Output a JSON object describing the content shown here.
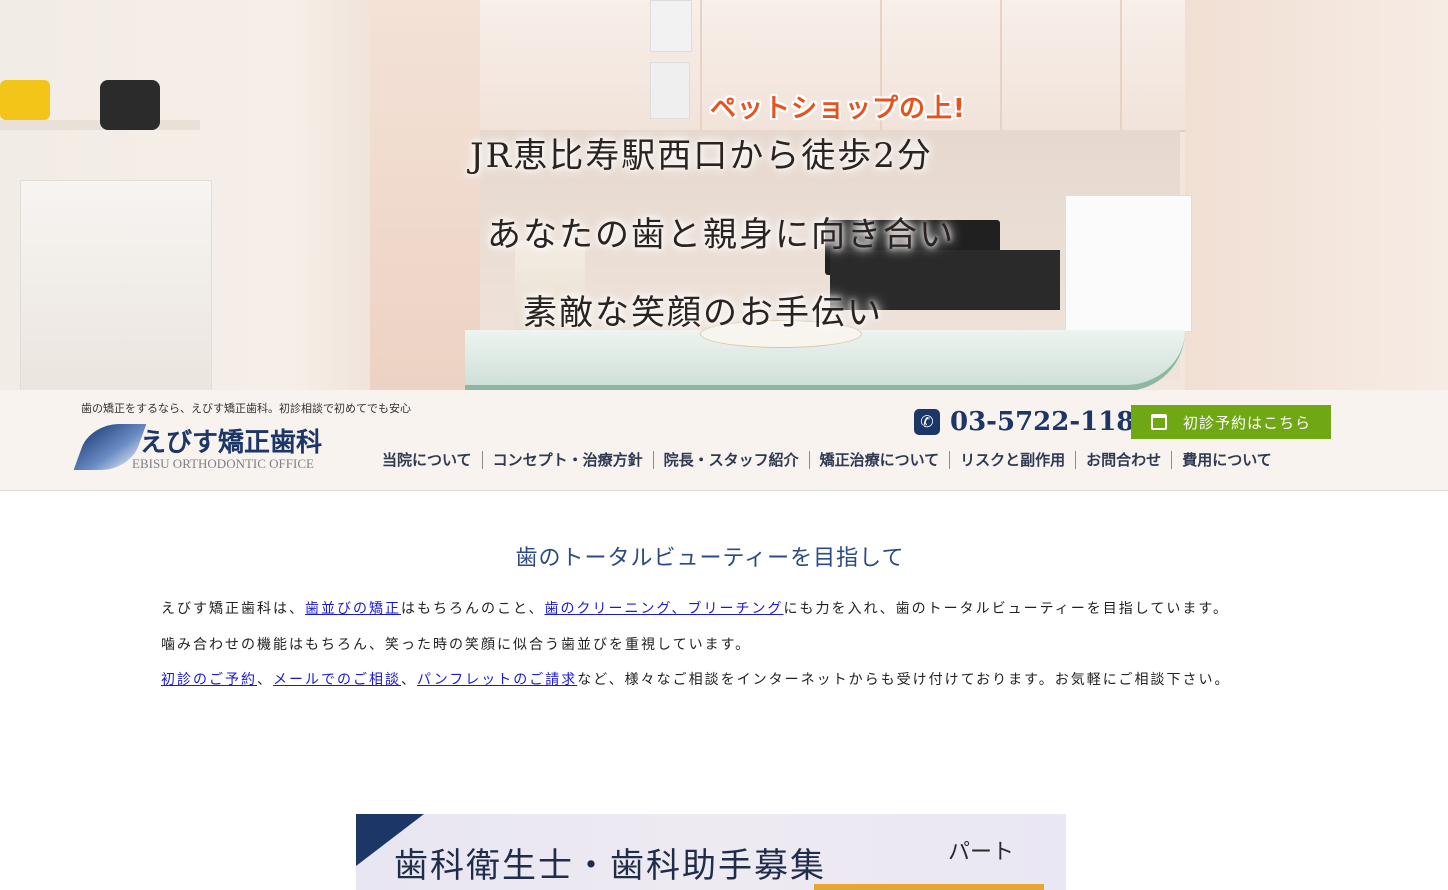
{
  "hero": {
    "pet_tag": "ペットショップの上!",
    "catch_lines": [
      "JR恵比寿駅西口から徒歩2分",
      "あなたの歯と親身に向き合い",
      "素敵な笑顔のお手伝い"
    ]
  },
  "header": {
    "tagline": "歯の矯正をするなら、えびす矯正歯科。初診相談で初めてでも安心",
    "logo_name": "えびす矯正歯科",
    "logo_en": "EBISU ORTHODONTIC OFFICE",
    "phone": "03-5722-1182",
    "reserve_label": "初診予約はこちら"
  },
  "nav": {
    "items": [
      {
        "label": "当院について"
      },
      {
        "label": "コンセプト・治療方針"
      },
      {
        "label": "院長・スタッフ紹介"
      },
      {
        "label": "矯正治療について"
      },
      {
        "label": "リスクと副作用"
      },
      {
        "label": "お問合わせ"
      },
      {
        "label": "費用について"
      }
    ]
  },
  "main": {
    "title": "歯のトータルビューティーを目指して",
    "para1": {
      "t1": "えびす矯正歯科は、",
      "link1": "歯並びの矯正",
      "t2": "はもちろんのこと、",
      "link2": "歯のクリーニング、ブリーチング",
      "t3": "にも力を入れ、歯のトータルビューティーを目指しています。"
    },
    "para2": "噛み合わせの機能はもちろん、笑った時の笑顔に似合う歯並びを重視しています。",
    "para3": {
      "link1": "初診のご予約",
      "sep1": "、",
      "link2": "メールでのご相談",
      "sep2": "、",
      "link3": "パンフレットのご請求",
      "t1": "など、様々なご相談をインターネットからも受け付けております。お気軽にご相談下さい。"
    }
  },
  "banner": {
    "title": "歯科衛生士・歯科助手募集",
    "badge": "パート"
  },
  "colors": {
    "brand_navy": "#1d3668",
    "reserve_green": "#6fa814",
    "link_blue": "#1a1ad6",
    "pet_orange": "#e8531c"
  }
}
